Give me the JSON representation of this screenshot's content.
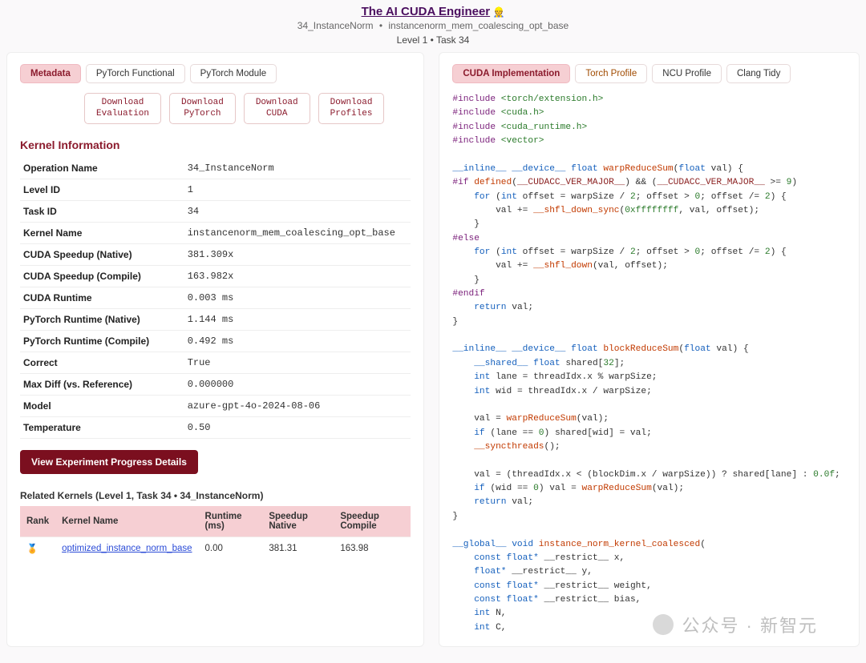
{
  "header": {
    "title": "The AI CUDA Engineer",
    "robot": "👷",
    "sub_a": "34_InstanceNorm",
    "sub_b": "instancenorm_mem_coalescing_opt_base",
    "level_line": "Level 1 • Task 34"
  },
  "left": {
    "tabs": [
      {
        "key": "metadata",
        "label": "Metadata",
        "active": true
      },
      {
        "key": "pytorch_functional",
        "label": "PyTorch Functional",
        "active": false
      },
      {
        "key": "pytorch_module",
        "label": "PyTorch Module",
        "active": false
      }
    ],
    "downloads": [
      {
        "l1": "Download",
        "l2": "Evaluation"
      },
      {
        "l1": "Download",
        "l2": "PyTorch"
      },
      {
        "l1": "Download",
        "l2": "CUDA"
      },
      {
        "l1": "Download",
        "l2": "Profiles"
      }
    ],
    "section_title": "Kernel Information",
    "kv": [
      {
        "k": "Operation Name",
        "v": "34_InstanceNorm"
      },
      {
        "k": "Level ID",
        "v": "1"
      },
      {
        "k": "Task ID",
        "v": "34"
      },
      {
        "k": "Kernel Name",
        "v": "instancenorm_mem_coalescing_opt_base"
      },
      {
        "k": "CUDA Speedup (Native)",
        "v": "381.309x"
      },
      {
        "k": "CUDA Speedup (Compile)",
        "v": "163.982x"
      },
      {
        "k": "CUDA Runtime",
        "v": "0.003 ms"
      },
      {
        "k": "PyTorch Runtime (Native)",
        "v": "1.144 ms"
      },
      {
        "k": "PyTorch Runtime (Compile)",
        "v": "0.492 ms"
      },
      {
        "k": "Correct",
        "v": "True"
      },
      {
        "k": "Max Diff (vs. Reference)",
        "v": "0.000000"
      },
      {
        "k": "Model",
        "v": "azure-gpt-4o-2024-08-06"
      },
      {
        "k": "Temperature",
        "v": "0.50"
      }
    ],
    "button": "View Experiment Progress Details",
    "related_heading": "Related Kernels (Level 1, Task 34 • 34_InstanceNorm)",
    "table": {
      "head": [
        "Rank",
        "Kernel Name",
        "Runtime (ms)",
        "Speedup Native",
        "Speedup Compile"
      ],
      "rows": [
        {
          "rank_emoji": "🏅",
          "name": "optimized_instance_norm_base",
          "runtime": "0.00",
          "sn": "381.31",
          "sc": "163.98"
        }
      ]
    }
  },
  "right": {
    "tabs": [
      {
        "key": "cuda_impl",
        "label": "CUDA Implementation",
        "active": true,
        "warn": false
      },
      {
        "key": "torch_profile",
        "label": "Torch Profile",
        "active": false,
        "warn": true
      },
      {
        "key": "ncu_profile",
        "label": "NCU Profile",
        "active": false,
        "warn": false
      },
      {
        "key": "clang_tidy",
        "label": "Clang Tidy",
        "active": false,
        "warn": false
      }
    ],
    "code_tokens": [
      [
        "pp",
        "#include "
      ],
      [
        "inc",
        "<torch/extension.h>"
      ],
      [
        "",
        "\n"
      ],
      [
        "pp",
        "#include "
      ],
      [
        "inc",
        "<cuda.h>"
      ],
      [
        "",
        "\n"
      ],
      [
        "pp",
        "#include "
      ],
      [
        "inc",
        "<cuda_runtime.h>"
      ],
      [
        "",
        "\n"
      ],
      [
        "pp",
        "#include "
      ],
      [
        "inc",
        "<vector>"
      ],
      [
        "",
        "\n"
      ],
      [
        "",
        "\n"
      ],
      [
        "kw",
        "__inline__ __device__ "
      ],
      [
        "ty",
        "float "
      ],
      [
        "fn",
        "warpReduceSum"
      ],
      [
        "",
        "("
      ],
      [
        "ty",
        "float"
      ],
      [
        "",
        " val) {\n"
      ],
      [
        "pp",
        "#if "
      ],
      [
        "fn",
        "defined"
      ],
      [
        "",
        "("
      ],
      [
        "id",
        "__CUDACC_VER_MAJOR__"
      ],
      [
        "",
        ") && ("
      ],
      [
        "id",
        "__CUDACC_VER_MAJOR__"
      ],
      [
        "",
        " >= "
      ],
      [
        "num",
        "9"
      ],
      [
        "",
        ")\n"
      ],
      [
        "",
        "    "
      ],
      [
        "kw",
        "for"
      ],
      [
        "",
        " ("
      ],
      [
        "ty",
        "int"
      ],
      [
        "",
        " offset = warpSize / "
      ],
      [
        "num",
        "2"
      ],
      [
        "",
        "; offset > "
      ],
      [
        "num",
        "0"
      ],
      [
        "",
        "; offset /= "
      ],
      [
        "num",
        "2"
      ],
      [
        "",
        ") {\n"
      ],
      [
        "",
        "        val += "
      ],
      [
        "fn",
        "__shfl_down_sync"
      ],
      [
        "",
        "("
      ],
      [
        "num",
        "0xffffffff"
      ],
      [
        "",
        ", val, offset);\n"
      ],
      [
        "",
        "    }\n"
      ],
      [
        "pp",
        "#else"
      ],
      [
        "",
        "\n"
      ],
      [
        "",
        "    "
      ],
      [
        "kw",
        "for"
      ],
      [
        "",
        " ("
      ],
      [
        "ty",
        "int"
      ],
      [
        "",
        " offset = warpSize / "
      ],
      [
        "num",
        "2"
      ],
      [
        "",
        "; offset > "
      ],
      [
        "num",
        "0"
      ],
      [
        "",
        "; offset /= "
      ],
      [
        "num",
        "2"
      ],
      [
        "",
        ") {\n"
      ],
      [
        "",
        "        val += "
      ],
      [
        "fn",
        "__shfl_down"
      ],
      [
        "",
        "(val, offset);\n"
      ],
      [
        "",
        "    }\n"
      ],
      [
        "pp",
        "#endif"
      ],
      [
        "",
        "\n"
      ],
      [
        "",
        "    "
      ],
      [
        "kw",
        "return"
      ],
      [
        "",
        " val;\n"
      ],
      [
        "",
        "}\n\n"
      ],
      [
        "kw",
        "__inline__ __device__ "
      ],
      [
        "ty",
        "float "
      ],
      [
        "fn",
        "blockReduceSum"
      ],
      [
        "",
        "("
      ],
      [
        "ty",
        "float"
      ],
      [
        "",
        " val) {\n"
      ],
      [
        "",
        "    "
      ],
      [
        "kw",
        "__shared__ "
      ],
      [
        "ty",
        "float"
      ],
      [
        "",
        " shared["
      ],
      [
        "num",
        "32"
      ],
      [
        "",
        "];\n"
      ],
      [
        "",
        "    "
      ],
      [
        "ty",
        "int"
      ],
      [
        "",
        " lane = threadIdx.x % warpSize;\n"
      ],
      [
        "",
        "    "
      ],
      [
        "ty",
        "int"
      ],
      [
        "",
        " wid = threadIdx.x / warpSize;\n\n"
      ],
      [
        "",
        "    val = "
      ],
      [
        "fn",
        "warpReduceSum"
      ],
      [
        "",
        "(val);\n"
      ],
      [
        "",
        "    "
      ],
      [
        "kw",
        "if"
      ],
      [
        "",
        " (lane == "
      ],
      [
        "num",
        "0"
      ],
      [
        "",
        ") shared[wid] = val;\n"
      ],
      [
        "",
        "    "
      ],
      [
        "fn",
        "__syncthreads"
      ],
      [
        "",
        "();\n\n"
      ],
      [
        "",
        "    val = (threadIdx.x < (blockDim.x / warpSize)) ? shared[lane] : "
      ],
      [
        "num",
        "0.0f"
      ],
      [
        "",
        ";\n"
      ],
      [
        "",
        "    "
      ],
      [
        "kw",
        "if"
      ],
      [
        "",
        " (wid == "
      ],
      [
        "num",
        "0"
      ],
      [
        "",
        ") val = "
      ],
      [
        "fn",
        "warpReduceSum"
      ],
      [
        "",
        "(val);\n"
      ],
      [
        "",
        "    "
      ],
      [
        "kw",
        "return"
      ],
      [
        "",
        " val;\n"
      ],
      [
        "",
        "}\n\n"
      ],
      [
        "kw",
        "__global__ "
      ],
      [
        "ty",
        "void "
      ],
      [
        "fn",
        "instance_norm_kernel_coalesced"
      ],
      [
        "",
        "(\n"
      ],
      [
        "",
        "    "
      ],
      [
        "kw",
        "const "
      ],
      [
        "ty",
        "float*"
      ],
      [
        "",
        " __restrict__ x,\n"
      ],
      [
        "",
        "    "
      ],
      [
        "ty",
        "float*"
      ],
      [
        "",
        " __restrict__ y,\n"
      ],
      [
        "",
        "    "
      ],
      [
        "kw",
        "const "
      ],
      [
        "ty",
        "float*"
      ],
      [
        "",
        " __restrict__ weight,\n"
      ],
      [
        "",
        "    "
      ],
      [
        "kw",
        "const "
      ],
      [
        "ty",
        "float*"
      ],
      [
        "",
        " __restrict__ bias,\n"
      ],
      [
        "",
        "    "
      ],
      [
        "ty",
        "int"
      ],
      [
        "",
        " N,\n"
      ],
      [
        "",
        "    "
      ],
      [
        "ty",
        "int"
      ],
      [
        "",
        " C,\n"
      ]
    ]
  },
  "watermark": "公众号 · 新智元"
}
